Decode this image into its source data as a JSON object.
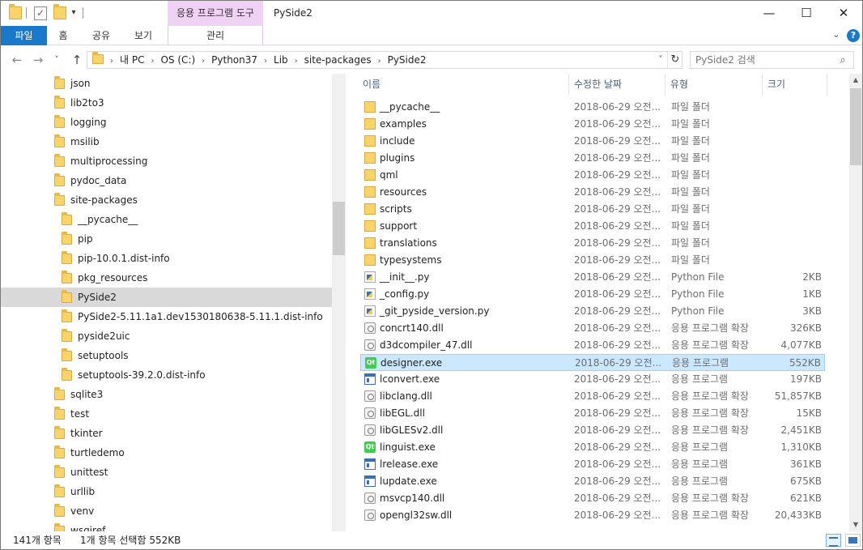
{
  "window": {
    "title": "PySide2",
    "ribbon_context_label": "응용 프로그램 도구",
    "controls": {
      "minimize": "—",
      "maximize": "☐",
      "close": "✕"
    }
  },
  "quick_access": {
    "customize_glyph": "▾"
  },
  "ribbon": {
    "tabs": [
      "파일",
      "홈",
      "공유",
      "보기"
    ],
    "manage_tab": "관리",
    "expand_glyph": "⌄",
    "help_glyph": "?"
  },
  "navigation": {
    "back_glyph": "←",
    "forward_glyph": "→",
    "recent_glyph": "˅",
    "up_glyph": "↑",
    "breadcrumb": [
      "내 PC",
      "OS (C:)",
      "Python37",
      "Lib",
      "site-packages",
      "PySide2"
    ],
    "breadcrumb_separator": "›",
    "leading_separator": "›",
    "dropdown_glyph": "˅",
    "refresh_glyph": "↻",
    "search_placeholder": "PySide2 검색",
    "search_glyph": "⌕"
  },
  "tree": {
    "items": [
      {
        "label": "json",
        "level": 1,
        "selected": false
      },
      {
        "label": "lib2to3",
        "level": 1,
        "selected": false
      },
      {
        "label": "logging",
        "level": 1,
        "selected": false
      },
      {
        "label": "msilib",
        "level": 1,
        "selected": false
      },
      {
        "label": "multiprocessing",
        "level": 1,
        "selected": false
      },
      {
        "label": "pydoc_data",
        "level": 1,
        "selected": false
      },
      {
        "label": "site-packages",
        "level": 1,
        "selected": false
      },
      {
        "label": "__pycache__",
        "level": 2,
        "selected": false
      },
      {
        "label": "pip",
        "level": 2,
        "selected": false
      },
      {
        "label": "pip-10.0.1.dist-info",
        "level": 2,
        "selected": false
      },
      {
        "label": "pkg_resources",
        "level": 2,
        "selected": false
      },
      {
        "label": "PySide2",
        "level": 2,
        "selected": true
      },
      {
        "label": "PySide2-5.11.1a1.dev1530180638-5.11.1.dist-info",
        "level": 2,
        "selected": false
      },
      {
        "label": "pyside2uic",
        "level": 2,
        "selected": false
      },
      {
        "label": "setuptools",
        "level": 2,
        "selected": false
      },
      {
        "label": "setuptools-39.2.0.dist-info",
        "level": 2,
        "selected": false
      },
      {
        "label": "sqlite3",
        "level": 1,
        "selected": false
      },
      {
        "label": "test",
        "level": 1,
        "selected": false
      },
      {
        "label": "tkinter",
        "level": 1,
        "selected": false
      },
      {
        "label": "turtledemo",
        "level": 1,
        "selected": false
      },
      {
        "label": "unittest",
        "level": 1,
        "selected": false
      },
      {
        "label": "urllib",
        "level": 1,
        "selected": false
      },
      {
        "label": "venv",
        "level": 1,
        "selected": false
      },
      {
        "label": "wsgiref",
        "level": 1,
        "selected": false
      }
    ]
  },
  "file_list": {
    "columns": {
      "name": "이름",
      "date": "수정한 날짜",
      "type": "유형",
      "size": "크기"
    },
    "sort_glyph": "^",
    "rows": [
      {
        "name": "__pycache__",
        "date": "2018-06-29 오전...",
        "type": "파일 폴더",
        "size": "",
        "icon": "folder-icon"
      },
      {
        "name": "examples",
        "date": "2018-06-29 오전...",
        "type": "파일 폴더",
        "size": "",
        "icon": "folder-icon"
      },
      {
        "name": "include",
        "date": "2018-06-29 오전...",
        "type": "파일 폴더",
        "size": "",
        "icon": "folder-icon"
      },
      {
        "name": "plugins",
        "date": "2018-06-29 오전...",
        "type": "파일 폴더",
        "size": "",
        "icon": "folder-icon"
      },
      {
        "name": "qml",
        "date": "2018-06-29 오전...",
        "type": "파일 폴더",
        "size": "",
        "icon": "folder-icon"
      },
      {
        "name": "resources",
        "date": "2018-06-29 오전...",
        "type": "파일 폴더",
        "size": "",
        "icon": "folder-icon"
      },
      {
        "name": "scripts",
        "date": "2018-06-29 오전...",
        "type": "파일 폴더",
        "size": "",
        "icon": "folder-icon"
      },
      {
        "name": "support",
        "date": "2018-06-29 오전...",
        "type": "파일 폴더",
        "size": "",
        "icon": "folder-icon"
      },
      {
        "name": "translations",
        "date": "2018-06-29 오전...",
        "type": "파일 폴더",
        "size": "",
        "icon": "folder-icon"
      },
      {
        "name": "typesystems",
        "date": "2018-06-29 오전...",
        "type": "파일 폴더",
        "size": "",
        "icon": "folder-icon"
      },
      {
        "name": "__init__.py",
        "date": "2018-06-29 오전...",
        "type": "Python File",
        "size": "2KB",
        "icon": "python-file-icon"
      },
      {
        "name": "_config.py",
        "date": "2018-06-29 오전...",
        "type": "Python File",
        "size": "1KB",
        "icon": "python-file-icon"
      },
      {
        "name": "_git_pyside_version.py",
        "date": "2018-06-29 오전...",
        "type": "Python File",
        "size": "3KB",
        "icon": "python-file-icon"
      },
      {
        "name": "concrt140.dll",
        "date": "2018-06-29 오전...",
        "type": "응용 프로그램 확장",
        "size": "326KB",
        "icon": "dll-icon"
      },
      {
        "name": "d3dcompiler_47.dll",
        "date": "2018-06-29 오전...",
        "type": "응용 프로그램 확장",
        "size": "4,077KB",
        "icon": "dll-icon"
      },
      {
        "name": "designer.exe",
        "date": "2018-06-29 오전...",
        "type": "응용 프로그램",
        "size": "552KB",
        "icon": "qt-app-icon",
        "selected": true
      },
      {
        "name": "lconvert.exe",
        "date": "2018-06-29 오전...",
        "type": "응용 프로그램",
        "size": "197KB",
        "icon": "exe-window-icon"
      },
      {
        "name": "libclang.dll",
        "date": "2018-06-29 오전...",
        "type": "응용 프로그램 확장",
        "size": "51,857KB",
        "icon": "dll-icon"
      },
      {
        "name": "libEGL.dll",
        "date": "2018-06-29 오전...",
        "type": "응용 프로그램 확장",
        "size": "15KB",
        "icon": "dll-icon"
      },
      {
        "name": "libGLESv2.dll",
        "date": "2018-06-29 오전...",
        "type": "응용 프로그램 확장",
        "size": "2,451KB",
        "icon": "dll-icon"
      },
      {
        "name": "linguist.exe",
        "date": "2018-06-29 오전...",
        "type": "응용 프로그램",
        "size": "1,310KB",
        "icon": "qt-app-icon"
      },
      {
        "name": "lrelease.exe",
        "date": "2018-06-29 오전...",
        "type": "응용 프로그램",
        "size": "361KB",
        "icon": "exe-window-icon"
      },
      {
        "name": "lupdate.exe",
        "date": "2018-06-29 오전...",
        "type": "응용 프로그램",
        "size": "675KB",
        "icon": "exe-window-icon"
      },
      {
        "name": "msvcp140.dll",
        "date": "2018-06-29 오전...",
        "type": "응용 프로그램 확장",
        "size": "621KB",
        "icon": "dll-icon"
      },
      {
        "name": "opengl32sw.dll",
        "date": "2018-06-29 오전...",
        "type": "응용 프로그램 확장",
        "size": "20,433KB",
        "icon": "dll-icon"
      }
    ]
  },
  "scrollbars": {
    "up_glyph": "▲",
    "down_glyph": "▼"
  },
  "status": {
    "item_count": "141개 항목",
    "selection": "1개 항목 선택함 552KB"
  }
}
